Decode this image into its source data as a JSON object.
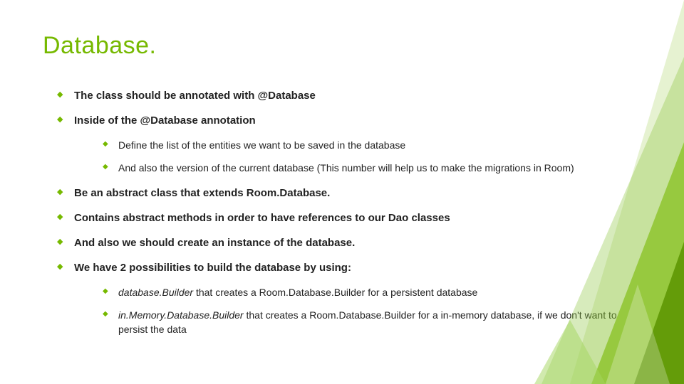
{
  "title": "Database.",
  "b1": "The class should be annotated with @Database",
  "b2": "Inside of the @Database annotation",
  "b2_1": "Define the list of the entities we want to be saved in the database",
  "b2_2": "And also the version of the current database (This number will help us to make the migrations in Room)",
  "b3": "Be an abstract class that extends Room.Database.",
  "b4": "Contains abstract methods in order to have references to our Dao classes",
  "b5": "And also we should create an instance of the database.",
  "b6": "We have 2 possibilities to build the database by using:",
  "b6_1a": "database.Builder",
  "b6_1b": " that creates a Room.Database.Builder for a persistent database",
  "b6_2a": "in.Memory.Database.Builder",
  "b6_2b": " that creates a Room.Database.Builder for a in-memory database, if we don't want to persist the data"
}
